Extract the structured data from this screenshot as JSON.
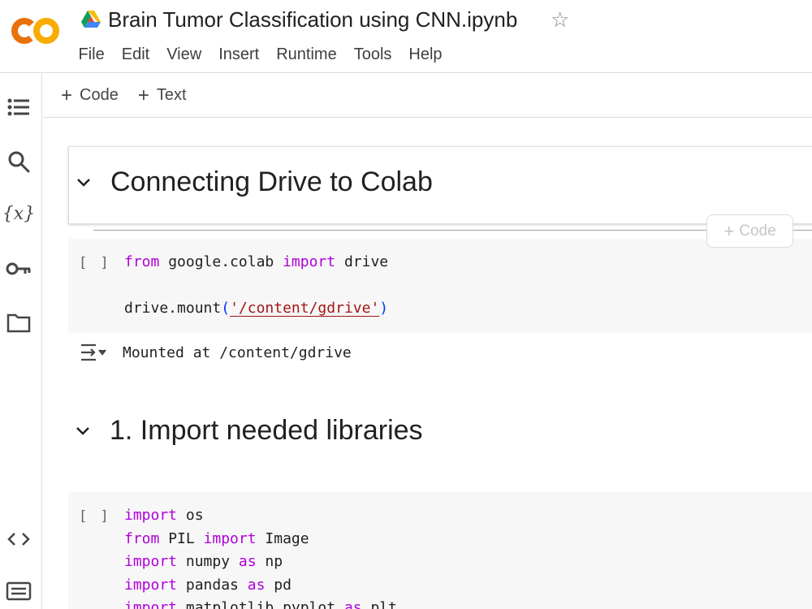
{
  "header": {
    "logo_text": "CO",
    "title": "Brain Tumor Classification using CNN.ipynb",
    "star_icon": "star-icon",
    "drive_icon": "google-drive-icon",
    "menu": [
      "File",
      "Edit",
      "View",
      "Insert",
      "Runtime",
      "Tools",
      "Help"
    ]
  },
  "rail": {
    "icons": [
      "table-of-contents-icon",
      "search-icon",
      "variables-icon",
      "secrets-key-icon",
      "files-folder-icon",
      "code-snippets-icon",
      "command-palette-icon"
    ],
    "variables_glyph": "{x}"
  },
  "toolbar": {
    "add_code": "Code",
    "add_text": "Text"
  },
  "notebook": {
    "floating_add_code": "Code",
    "cells": [
      {
        "type": "text",
        "heading": "Connecting Drive to Colab"
      },
      {
        "type": "code",
        "run_bracket": "[ ]",
        "lines": [
          [
            {
              "t": "from",
              "c": "kw"
            },
            {
              "t": " google.colab "
            },
            {
              "t": "import",
              "c": "kw"
            },
            {
              "t": " drive"
            }
          ],
          [
            {
              "t": ""
            }
          ],
          [
            {
              "t": "drive.mount"
            },
            {
              "t": "(",
              "c": "par"
            },
            {
              "t": "'/content/gdrive'",
              "c": "str"
            },
            {
              "t": ")",
              "c": "par"
            }
          ]
        ],
        "output": "Mounted at /content/gdrive"
      },
      {
        "type": "text",
        "heading": "1. Import needed libraries"
      },
      {
        "type": "code",
        "run_bracket": "[ ]",
        "lines": [
          [
            {
              "t": "import",
              "c": "kw"
            },
            {
              "t": " os"
            }
          ],
          [
            {
              "t": "from",
              "c": "kw"
            },
            {
              "t": " PIL "
            },
            {
              "t": "import",
              "c": "kw"
            },
            {
              "t": " Image"
            }
          ],
          [
            {
              "t": "import",
              "c": "kw"
            },
            {
              "t": " numpy "
            },
            {
              "t": "as",
              "c": "kw"
            },
            {
              "t": " np"
            }
          ],
          [
            {
              "t": "import",
              "c": "kw"
            },
            {
              "t": " pandas "
            },
            {
              "t": "as",
              "c": "kw"
            },
            {
              "t": " pd"
            }
          ],
          [
            {
              "t": "import",
              "c": "kw"
            },
            {
              "t": " matplotlib.pyplot "
            },
            {
              "t": "as",
              "c": "kw"
            },
            {
              "t": " plt"
            }
          ]
        ]
      }
    ]
  },
  "colors": {
    "keyword": "#af00db",
    "string": "#a31515",
    "paren": "#0431fa",
    "logo_orange": "#f9ab00",
    "logo_dark_orange": "#e8710a"
  }
}
